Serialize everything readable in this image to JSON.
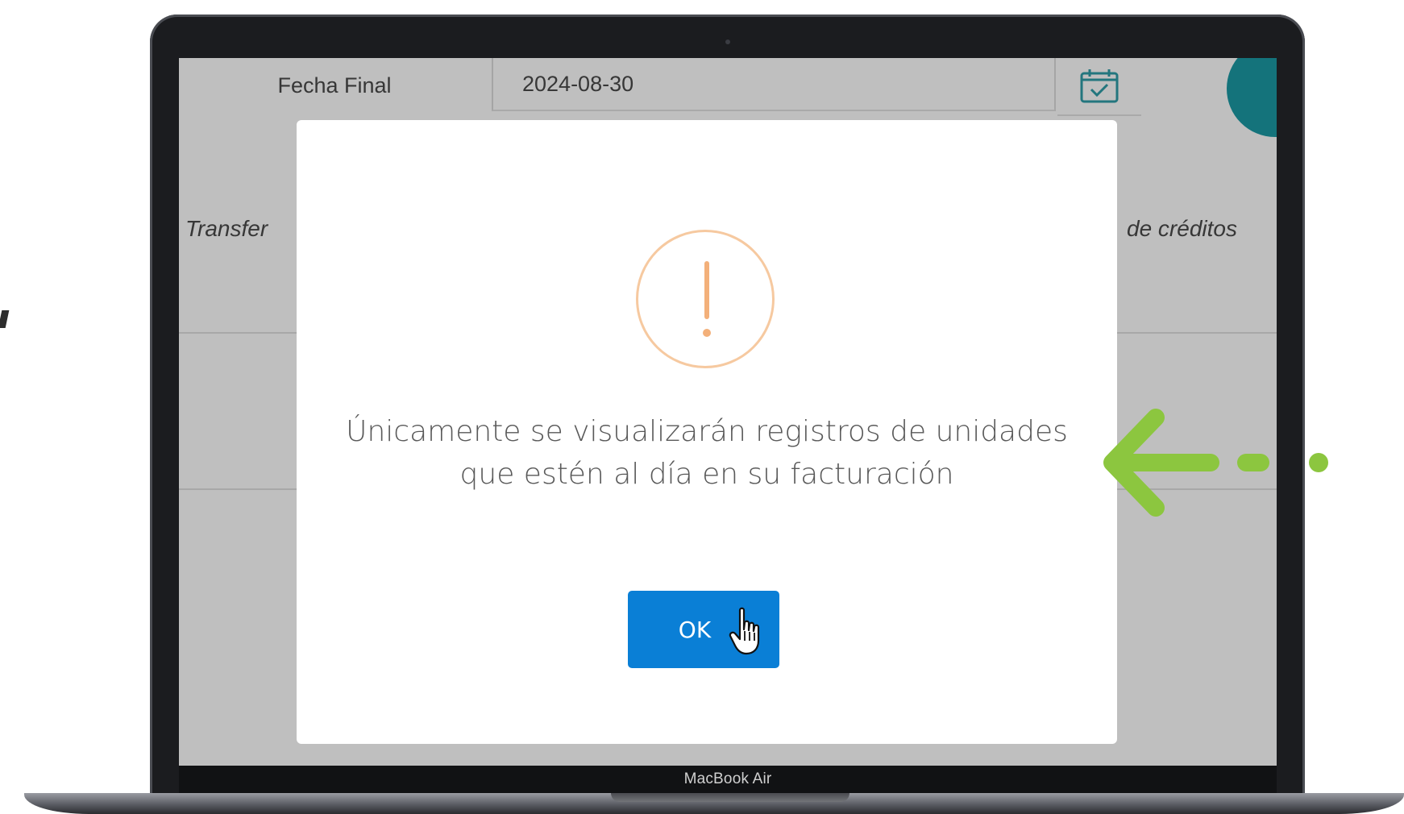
{
  "device": {
    "label": "MacBook Air"
  },
  "background_page": {
    "date_field": {
      "label": "Fecha Final",
      "value": "2024-08-30"
    },
    "calendar_icon": "calendar-check-icon",
    "column_headers": {
      "left": "Transfer",
      "right": "de créditos"
    }
  },
  "modal": {
    "icon": "warning-exclamation-icon",
    "message": "Únicamente se visualizarán registros de unidades que estén al día en su facturación",
    "ok_label": "OK"
  },
  "cursor": "hand-pointer-icon",
  "callout": {
    "icon": "arrow-left-icon",
    "color": "#8cc63f"
  },
  "colors": {
    "accent": "#0a7fd6",
    "warning": "#f3b07a",
    "teal": "#1b9aa5"
  }
}
